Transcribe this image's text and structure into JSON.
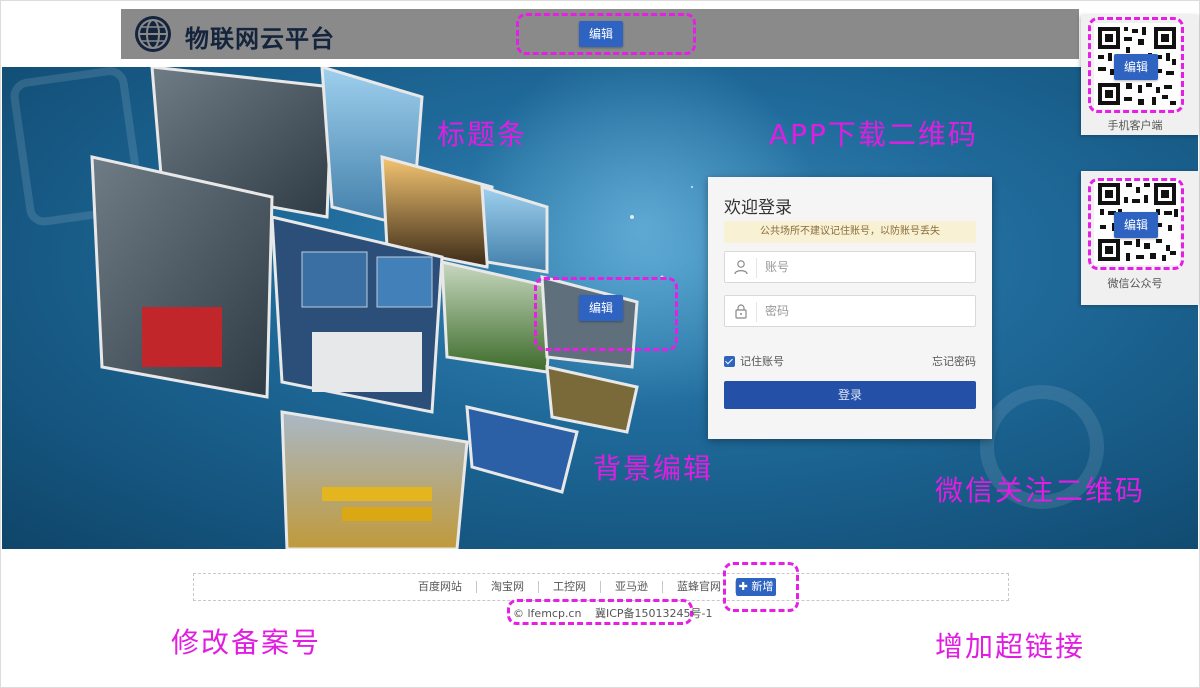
{
  "header": {
    "brand": "物联网云平台",
    "edit_label": "编辑"
  },
  "annotations": {
    "title_bar": "标题条",
    "app_qr": "APP下载二维码",
    "background_edit": "背景编辑",
    "wechat_qr": "微信关注二维码",
    "edit_icp": "修改备案号",
    "add_link": "增加超链接"
  },
  "background": {
    "edit_label": "编辑"
  },
  "login": {
    "title": "欢迎登录",
    "tip": "公共场所不建议记住账号，以防账号丢失",
    "account_placeholder": "账号",
    "password_placeholder": "密码",
    "remember_label": "记住账号",
    "remember_checked": true,
    "forgot_label": "忘记密码",
    "submit_label": "登录"
  },
  "qr": {
    "app": {
      "label": "手机客户端",
      "edit_label": "编辑"
    },
    "wechat": {
      "label": "微信公众号",
      "edit_label": "编辑"
    }
  },
  "footer": {
    "links": [
      "百度网站",
      "淘宝网",
      "工控网",
      "亚马逊",
      "蓝蜂官网"
    ],
    "add_label": "✚ 新增",
    "copyright": "© lfemcp.cn",
    "icp": "冀ICP备15013245号-1"
  },
  "colors": {
    "accent": "#2f63c2",
    "annotation": "#e21de2",
    "header_bg": "#8a8a8a",
    "hero_bg": "#1f6a9a"
  }
}
